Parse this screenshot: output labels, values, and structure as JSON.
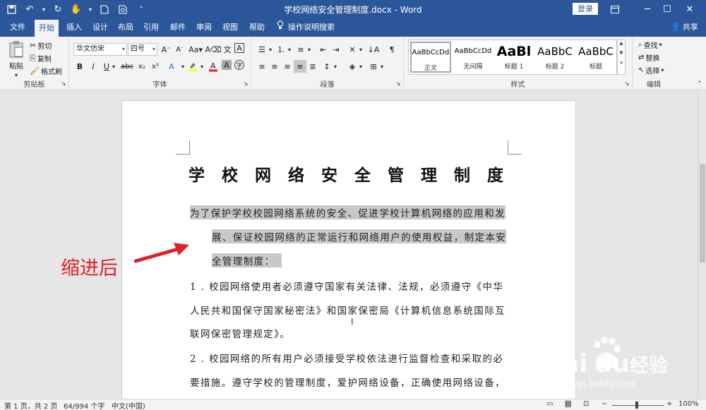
{
  "titlebar": {
    "title": "学校网络安全管理制度.docx - Word",
    "login_label": "登录",
    "controls": [
      "restore-ribbon-icon",
      "minimize-icon",
      "maximize-icon",
      "close-icon"
    ]
  },
  "tabs": {
    "file": "文件",
    "home": "开始",
    "insert": "插入",
    "design": "设计",
    "layout": "布局",
    "references": "引用",
    "mailings": "邮件",
    "review": "审阅",
    "view": "视图",
    "help": "帮助",
    "tell_me": "操作说明搜索",
    "share": "共享"
  },
  "ribbon": {
    "clipboard": {
      "label": "剪贴板",
      "paste": "粘贴",
      "cut": "剪切",
      "copy": "复制",
      "format_painter": "格式刷"
    },
    "font": {
      "label": "字体",
      "font_name": "华文仿宋",
      "font_size": "四号"
    },
    "paragraph": {
      "label": "段落"
    },
    "styles": {
      "label": "样式",
      "items": [
        {
          "sample": "AaBbCcDd",
          "name": "正文"
        },
        {
          "sample": "AaBbCcDd",
          "name": "无间隔"
        },
        {
          "sample": "AaBl",
          "name": "标题 1"
        },
        {
          "sample": "AaBbC",
          "name": "标题 2"
        },
        {
          "sample": "AaBbC",
          "name": "标题"
        }
      ]
    },
    "editing": {
      "label": "编辑",
      "find": "查找",
      "replace": "替换",
      "select": "选择"
    }
  },
  "document": {
    "title": "学 校 网 络 安 全 管 理 制 度",
    "intro_lines": [
      "为了保护学校校园网络系统的安全、促进学校计算机网络的应用和发",
      "展、保证校园网络的正常运行和网络用户的使用权益，制定本安",
      "全管理制度："
    ],
    "item1_lines": [
      "1 . 校园网络使用者必须遵守国家有关法律、法规，必须遵守《中华",
      "人民共和国保守国家秘密法》和国家保密局《计算机信息系统国际互",
      "联网保密管理规定》。"
    ],
    "item2_lines": [
      "2 . 校园网络的所有用户必须接受学校依法进行监督检查和采取的必",
      "要措施。遵守学校的管理制度，爱护网络设备，正确使用网络设备，"
    ]
  },
  "annotation": {
    "text": "缩进后",
    "color": "#e0202a"
  },
  "statusbar": {
    "page": "第 1 页，共 2 页",
    "words": "64/994 个字",
    "language": "中文(中国)",
    "zoom": "100%"
  },
  "watermark": {
    "brand": "Bai",
    "brand2": "du",
    "cn": "经验",
    "url": "jingyan.baidu.com"
  },
  "colors": {
    "accent": "#2b579a",
    "highlight": "#c8c8c8"
  }
}
